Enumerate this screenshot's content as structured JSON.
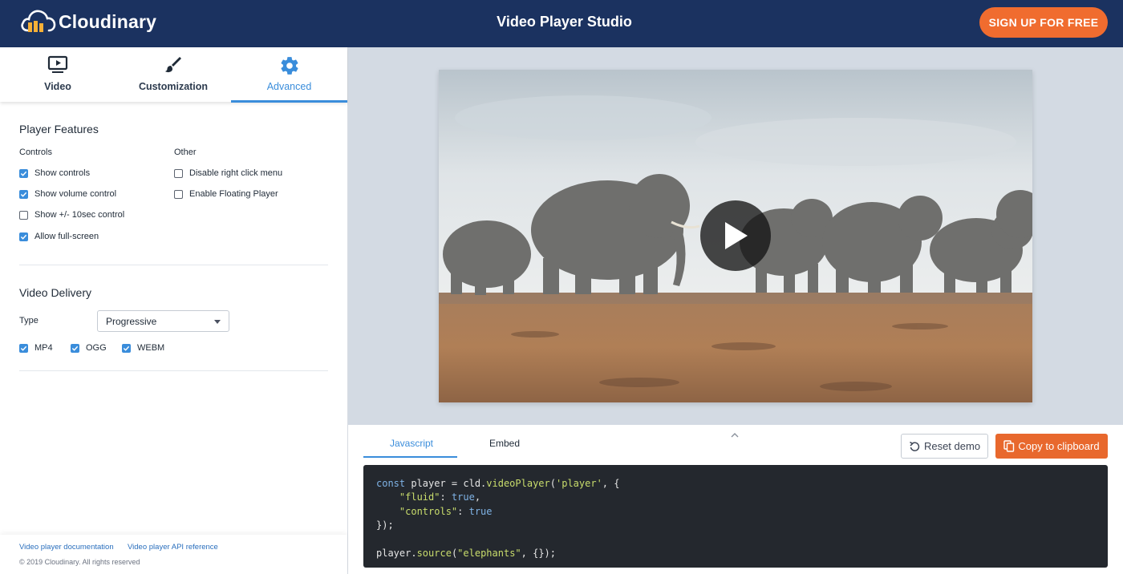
{
  "header": {
    "logo_text": "Cloudinary",
    "title": "Video Player Studio",
    "signup_label": "SIGN UP FOR FREE"
  },
  "tabs": [
    {
      "label": "Video",
      "icon": "video-screen-icon",
      "active": false
    },
    {
      "label": "Customization",
      "icon": "paintbrush-icon",
      "active": false
    },
    {
      "label": "Advanced",
      "icon": "gear-icon",
      "active": true
    }
  ],
  "player_features": {
    "title": "Player Features",
    "controls_label": "Controls",
    "other_label": "Other",
    "controls": [
      {
        "label": "Show controls",
        "checked": true
      },
      {
        "label": "Show volume control",
        "checked": true
      },
      {
        "label": "Show +/- 10sec control",
        "checked": false
      },
      {
        "label": "Allow full-screen",
        "checked": true
      }
    ],
    "other": [
      {
        "label": "Disable right click menu",
        "checked": false
      },
      {
        "label": "Enable Floating Player",
        "checked": false
      }
    ]
  },
  "video_delivery": {
    "title": "Video Delivery",
    "type_label": "Type",
    "type_value": "Progressive",
    "formats": [
      {
        "label": "MP4",
        "checked": true
      },
      {
        "label": "OGG",
        "checked": true
      },
      {
        "label": "WEBM",
        "checked": true
      }
    ]
  },
  "footer": {
    "docs_link": "Video player documentation",
    "api_link": "Video player API reference",
    "copyright": "© 2019 Cloudinary. All rights reserved"
  },
  "code_panel": {
    "tab_javascript": "Javascript",
    "tab_embed": "Embed",
    "active_tab": "Javascript",
    "reset_label": "Reset demo",
    "copy_label": "Copy to clipboard"
  },
  "colors": {
    "header_bg": "#1b3260",
    "accent": "#3a8ddb",
    "cta": "#f06c2f",
    "code_bg": "#24282e"
  }
}
